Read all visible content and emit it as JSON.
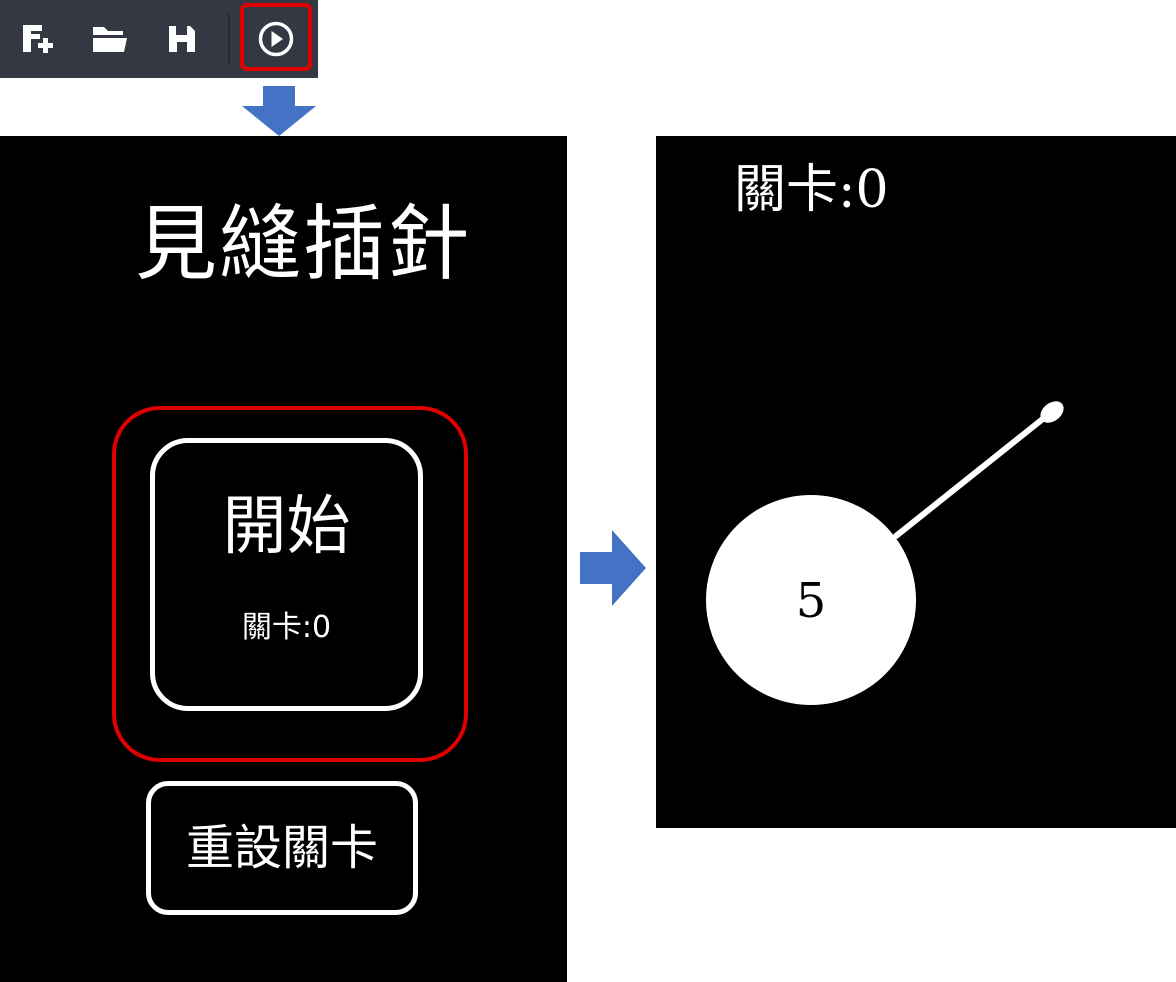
{
  "toolbar": {
    "buttons": [
      {
        "name": "new-project",
        "icon": "add-file-icon"
      },
      {
        "name": "open-project",
        "icon": "folder-open-icon"
      },
      {
        "name": "save-project",
        "icon": "save-icon"
      },
      {
        "name": "run",
        "icon": "play-circle-icon",
        "highlighted": true
      }
    ],
    "background_color": "#333842",
    "highlight_color": "#e00000"
  },
  "menu_screen": {
    "title": "見縫插針",
    "start_button": {
      "label": "開始",
      "level_text": "關卡:0",
      "highlighted": true
    },
    "reset_button": {
      "label": "重設關卡"
    }
  },
  "game_screen": {
    "level_text": "關卡:0",
    "target_circle_value": "5",
    "pins_stuck": 1
  },
  "arrows": {
    "color": "#4472c4",
    "icons": [
      "arrow-down-icon",
      "arrow-right-icon"
    ]
  }
}
